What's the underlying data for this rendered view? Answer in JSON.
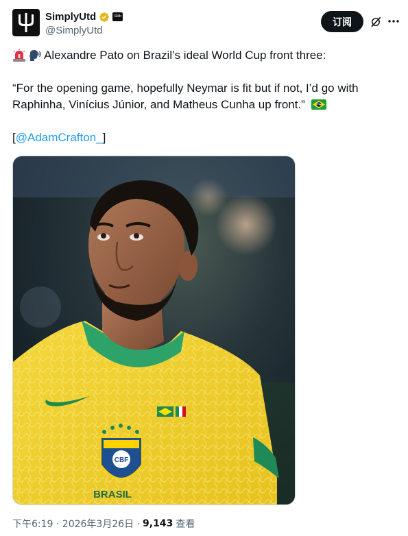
{
  "account": {
    "display_name": "SimplyUtd",
    "handle": "@SimplyUtd",
    "affiliate_badge": "SMb"
  },
  "actions": {
    "subscribe_label": "订阅",
    "grok_icon": "grok-slash-icon",
    "more_icon": "more-dots-icon"
  },
  "post": {
    "line1": "Alexandre Pato on Brazil’s ideal World Cup front three:",
    "quote_line1": "“For the opening game, hopefully Neymar is fit but if not, I’d go with",
    "quote_line2": "Raphinha, Vinícius Júnior, and Matheus Cunha up front.”",
    "bracket_open": "[",
    "mention": "@AdamCrafton_",
    "bracket_close": "]",
    "emojis": [
      "siren-emoji",
      "speaking-head-emoji",
      "brazil-flag-emoji"
    ]
  },
  "media": {
    "shirt_text": "BRASIL",
    "crest_text": "CBF"
  },
  "meta": {
    "time": "下午6:19 · 2026年3月26日 ·",
    "views": "9,143",
    "views_label": "查看"
  },
  "colors": {
    "mention": "#1d9bf0",
    "verified": "#e2b719",
    "subscribe_bg": "#0f1419",
    "secondary_text": "#536471"
  }
}
